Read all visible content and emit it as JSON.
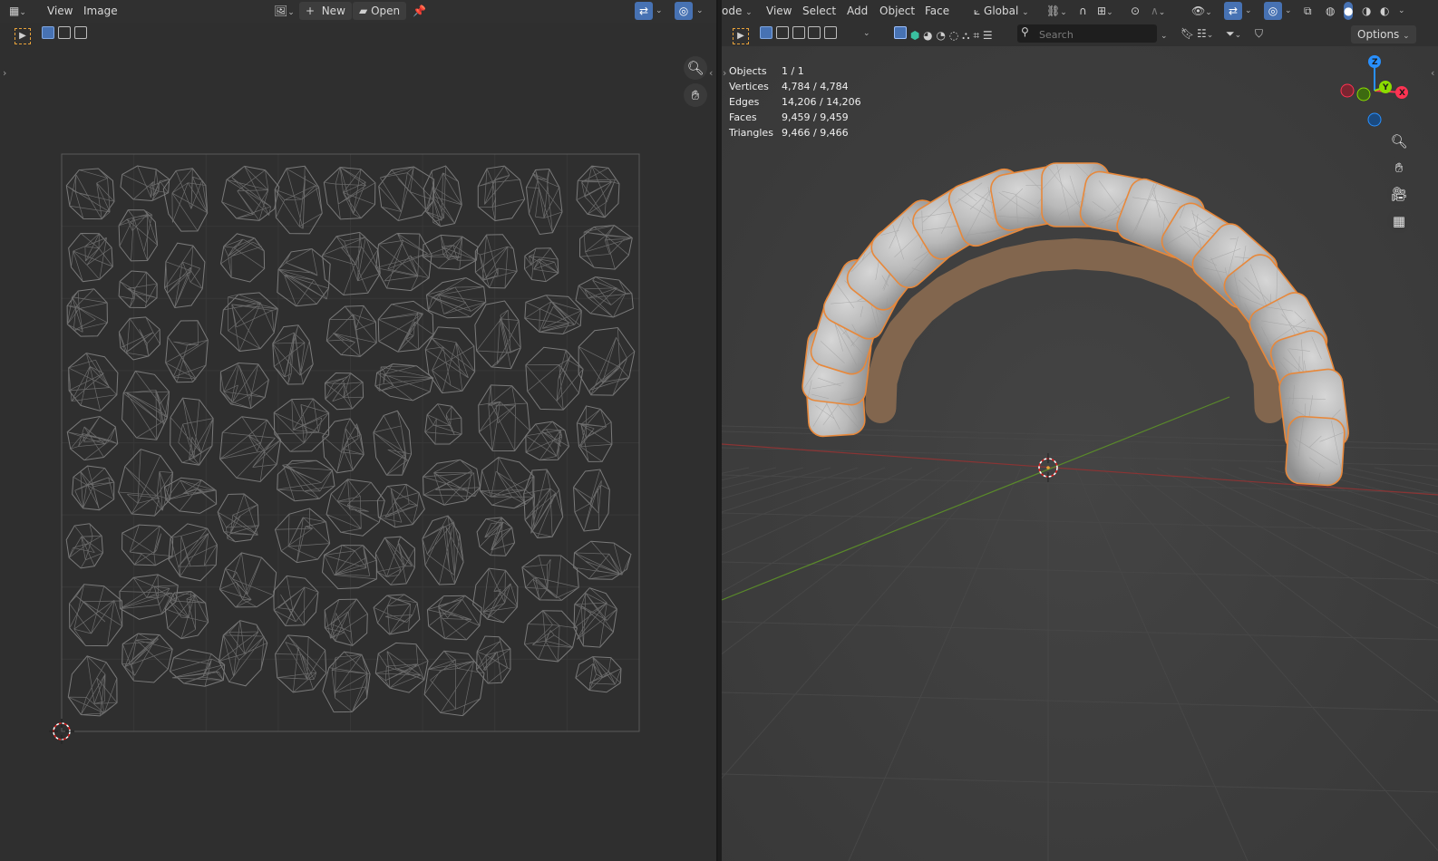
{
  "uv_editor": {
    "header": {
      "menus": [
        "View",
        "Image"
      ],
      "new_label": "New",
      "open_label": "Open"
    }
  },
  "viewport": {
    "header": {
      "mode_label": "ode",
      "menus": [
        "View",
        "Select",
        "Add",
        "Object",
        "Face"
      ],
      "orientation_label": "Global",
      "options_label": "Options"
    },
    "search": {
      "placeholder": "Search",
      "value": ""
    },
    "stats": [
      {
        "label": "Objects",
        "value": "1 / 1"
      },
      {
        "label": "Vertices",
        "value": "4,784 / 4,784"
      },
      {
        "label": "Edges",
        "value": "14,206 / 14,206"
      },
      {
        "label": "Faces",
        "value": "9,459 / 9,459"
      },
      {
        "label": "Triangles",
        "value": "9,466 / 9,466"
      }
    ],
    "gizmo": {
      "z": "Z",
      "y": "Y",
      "x": "X"
    }
  },
  "colors": {
    "accent_blue": "#4772b3",
    "selection_orange": "#e8883a",
    "axis_red": "#ff3352",
    "axis_green": "#8bdc00",
    "axis_blue": "#2890ff"
  }
}
